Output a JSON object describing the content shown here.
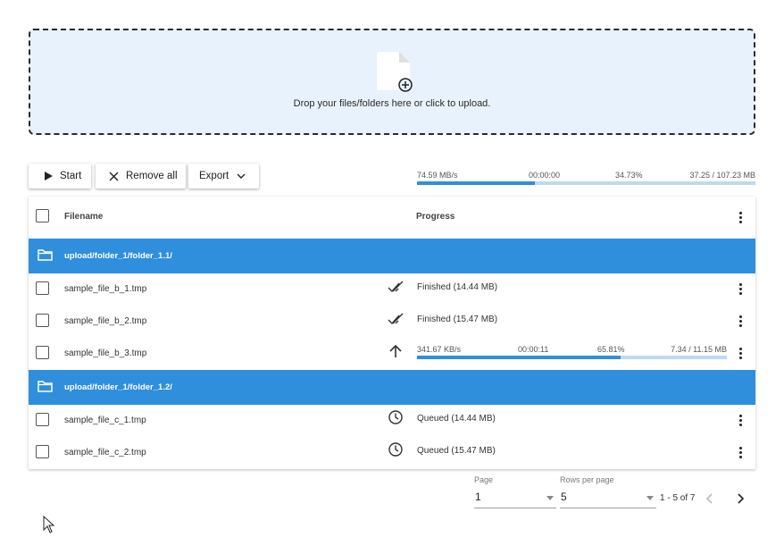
{
  "dropzone": {
    "text": "Drop your files/folders here or click to upload."
  },
  "toolbar": {
    "start_label": "Start",
    "remove_all_label": "Remove all",
    "export_label": "Export"
  },
  "overall": {
    "speed": "74.59 MB/s",
    "time": "00:00:00",
    "percent": "34.73%",
    "progress": 34.73,
    "size": "37.25 / 107.23 MB"
  },
  "table": {
    "headers": {
      "filename": "Filename",
      "progress": "Progress"
    },
    "folders": [
      {
        "path": "upload/folder_1/folder_1.1/"
      },
      {
        "path": "upload/folder_1/folder_1.2/"
      }
    ],
    "files": [
      {
        "name": "sample_file_b_1.tmp",
        "icon": "double-check-icon",
        "status": "Finished (14.44 MB)"
      },
      {
        "name": "sample_file_b_2.tmp",
        "icon": "double-check-icon",
        "status": "Finished (15.47 MB)"
      },
      {
        "name": "sample_file_b_3.tmp",
        "icon": "arrow-up-icon",
        "speed": "341.67 KB/s",
        "time": "00:00:11",
        "percent": "65.81%",
        "progress": 65.81,
        "size": "7.34 / 11.15 MB"
      },
      {
        "name": "sample_file_c_1.tmp",
        "icon": "clock-icon",
        "status": "Queued (14.44 MB)"
      },
      {
        "name": "sample_file_c_2.tmp",
        "icon": "clock-icon",
        "status": "Queued (15.47 MB)"
      }
    ]
  },
  "pagination": {
    "page_label": "Page",
    "page_value": "1",
    "rows_label": "Rows per page",
    "rows_value": "5",
    "range": "1 - 5 of 7"
  },
  "colors": {
    "accent": "#2f8fdd",
    "dropzone_bg": "#e7f2fc",
    "progress_track": "#bdd9f3"
  }
}
